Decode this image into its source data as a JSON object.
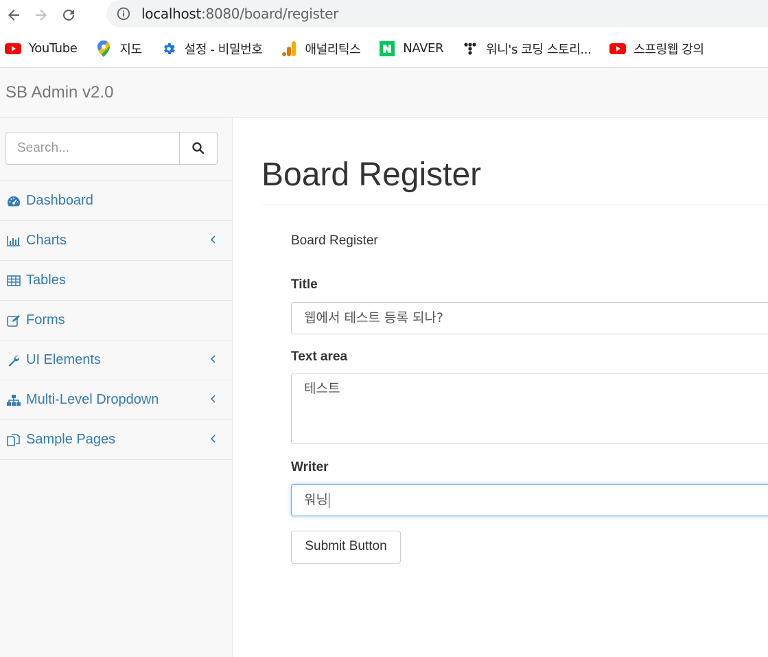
{
  "browser": {
    "url_host": "localhost",
    "url_path": ":8080/board/register",
    "bookmarks": [
      {
        "label": "YouTube",
        "icon": "youtube-icon"
      },
      {
        "label": "지도",
        "icon": "maps-pin-icon"
      },
      {
        "label": "설정 - 비밀번호",
        "icon": "gear-icon"
      },
      {
        "label": "애널리틱스",
        "icon": "analytics-icon"
      },
      {
        "label": "NAVER",
        "icon": "naver-icon"
      },
      {
        "label": "워니's 코딩 스토리...",
        "icon": "tistory-icon"
      },
      {
        "label": "스프링웹 강의",
        "icon": "youtube-icon"
      }
    ]
  },
  "navbar": {
    "brand": "SB Admin v2.0"
  },
  "sidebar": {
    "search_placeholder": "Search...",
    "items": [
      {
        "label": "Dashboard",
        "icon": "dashboard-icon",
        "has_submenu": false
      },
      {
        "label": "Charts",
        "icon": "bar-chart-icon",
        "has_submenu": true
      },
      {
        "label": "Tables",
        "icon": "table-icon",
        "has_submenu": false
      },
      {
        "label": "Forms",
        "icon": "edit-icon",
        "has_submenu": false
      },
      {
        "label": "UI Elements",
        "icon": "wrench-icon",
        "has_submenu": true
      },
      {
        "label": "Multi-Level Dropdown",
        "icon": "sitemap-icon",
        "has_submenu": true
      },
      {
        "label": "Sample Pages",
        "icon": "files-icon",
        "has_submenu": true
      }
    ]
  },
  "main": {
    "page_title": "Board Register",
    "panel_heading": "Board Register",
    "form": {
      "title_label": "Title",
      "title_value": "웹에서 테스트 등록 되나?",
      "text_label": "Text area",
      "text_value": "테스트",
      "writer_label": "Writer",
      "writer_value": "워닝",
      "submit_label": "Submit Button"
    }
  },
  "colors": {
    "link": "#337ab7",
    "navbar_bg": "#f8f8f8",
    "focus": "#66afe9"
  }
}
